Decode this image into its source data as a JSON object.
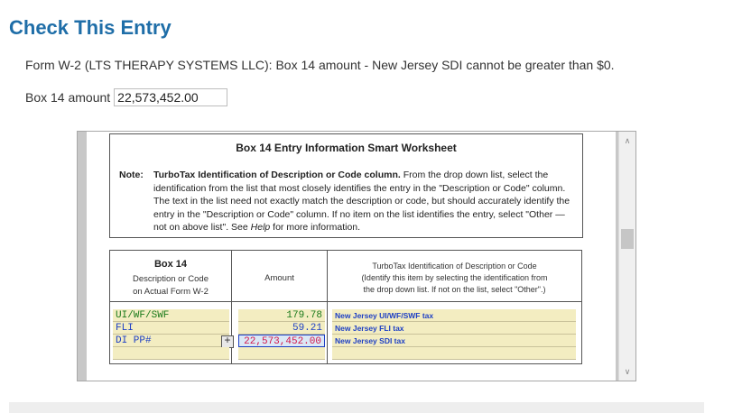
{
  "header": {
    "title": "Check This Entry"
  },
  "message": "Form W-2 (LTS THERAPY SYSTEMS LLC): Box 14 amount - New Jersey SDI cannot be greater than $0.",
  "amount_field": {
    "label": "Box 14 amount",
    "value": "22,573,452.00"
  },
  "worksheet": {
    "title": "Box 14 Entry Information Smart Worksheet",
    "note_label": "Note:",
    "note_bold": "TurboTax Identification of Description or Code column.",
    "note_text_1": " From the drop down list, select the identification from the list that most closely identifies the entry in the \"Description or Code\" column. The text in the list need not exactly match the description or code, but should accurately identify the entry in the \"Description or Code\" column. If no item on the list identifies the entry, select \"Other — not on above list\". See ",
    "note_help": "Help",
    "note_text_2": " for more information.",
    "columns": {
      "col1_title": "Box 14",
      "col1_sub1": "Description or Code",
      "col1_sub2": "on Actual Form W-2",
      "col2": "Amount",
      "col3_line1": "TurboTax Identification of Description or Code",
      "col3_line2": "(Identify this item by selecting the identification from",
      "col3_line3": "the drop down list. If not on the list, select \"Other\".)"
    },
    "rows": [
      {
        "desc": "UI/WF/SWF",
        "amount": "179.78",
        "id": "New Jersey UI/WF/SWF tax"
      },
      {
        "desc": "FLI",
        "amount": "59.21",
        "id": "New Jersey FLI tax"
      },
      {
        "desc": "DI PP#",
        "amount": "22,573,452.00",
        "id": "New Jersey SDI tax"
      }
    ]
  },
  "icons": {
    "expand": "plus-expand-icon",
    "scroll_up": "chevron-up-icon",
    "scroll_down": "chevron-down-icon"
  }
}
